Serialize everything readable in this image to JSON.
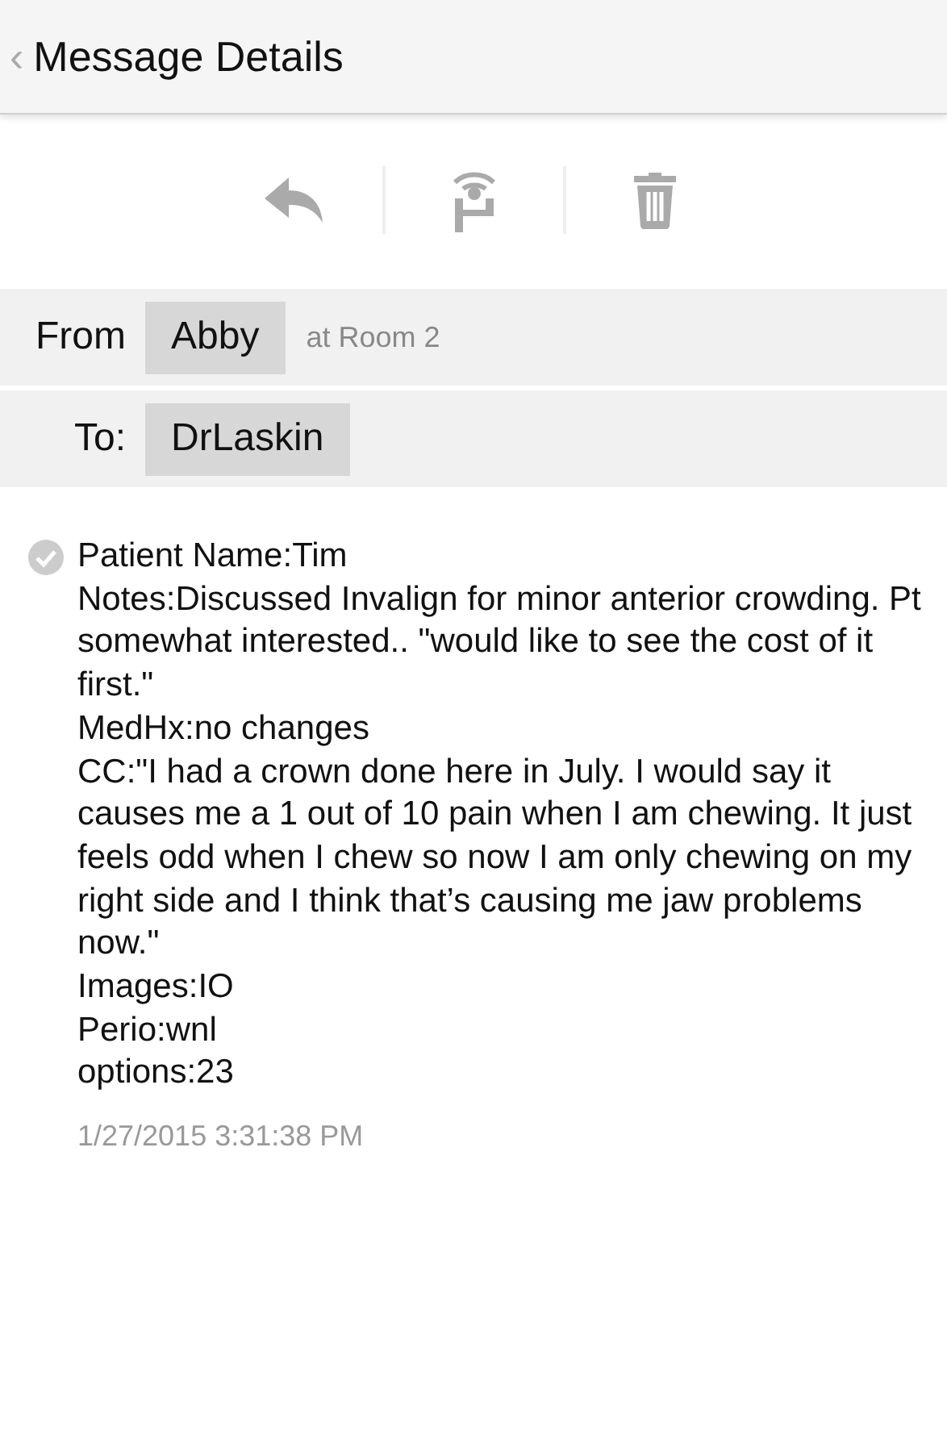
{
  "header": {
    "back_glyph": "‹",
    "title": "Message Details"
  },
  "toolbar": {
    "actions": [
      {
        "kind": "reply"
      },
      {
        "kind": "page"
      },
      {
        "kind": "delete"
      }
    ]
  },
  "from": {
    "label": "From",
    "sender": "Abby",
    "location": "at Room 2"
  },
  "to": {
    "label": "To:",
    "recipient": "DrLaskin"
  },
  "message": {
    "read": true,
    "lines": [
      "Patient Name:Tim",
      "Notes:Discussed Invalign for minor anterior crowding. Pt somewhat interested.. \"would like to see the cost of it first.\"",
      "MedHx:no changes",
      "CC:\"I had a crown done here in July. I would say it causes me a 1 out of 10 pain when I am chewing. It just feels odd when I chew so now I am only chewing on my right side and I think that’s causing me jaw problems now.\"",
      "Images:IO",
      "Perio:wnl",
      "options:23"
    ],
    "timestamp": "1/27/2015 3:31:38 PM"
  }
}
